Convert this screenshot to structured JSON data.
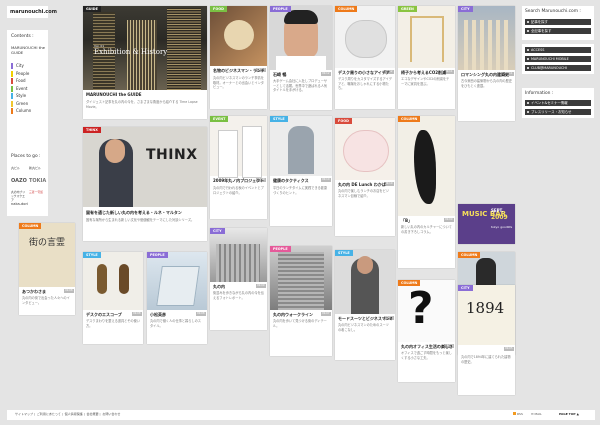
{
  "logo": "marunouchi.com",
  "contents": {
    "title": "Contents :",
    "guide": "MARUNOUCHI the GUIDE",
    "categories": [
      {
        "label": "City",
        "color": "#8a6dd6"
      },
      {
        "label": "People",
        "color": "#f2cf00"
      },
      {
        "label": "Food",
        "color": "#d94b3c"
      },
      {
        "label": "Event",
        "color": "#7ac043"
      },
      {
        "label": "Style",
        "color": "#46b2e6"
      },
      {
        "label": "Green",
        "color": "#f0c62e"
      },
      {
        "label": "Column",
        "color": "#ee7a1a"
      }
    ],
    "thinx": "THINX",
    "thinx_color": "#cc2222"
  },
  "places": {
    "title": "Places to go :",
    "logos": [
      "丸ビル",
      "新丸ビル",
      "OAZO",
      "TOKIA",
      "丸の内ブリックスクエア",
      "三菱一号館",
      "naka-dori"
    ]
  },
  "search": {
    "title": "Search Marunouchi.com :",
    "buttons": [
      "記事を探す",
      "全記事を探す"
    ]
  },
  "accounts": {
    "buttons": [
      "ACCESS",
      "MARUNOUCHI MOBILE",
      "CLUB@MARUNOUCHI"
    ]
  },
  "information": {
    "title": "Information :",
    "buttons": [
      "イベント&セミナー情報",
      "プレスリリース・お知らせ"
    ]
  },
  "cards": {
    "guide": {
      "tag": "GUIDE",
      "heading_small": "Vol. 01",
      "heading": "Exhibition & History",
      "title": "MARUNOUCHI the GUIDE",
      "text": "ダイジェスト記事を丸の内の今を、さまざまな角度から紹介する Time Lapse Movie。"
    },
    "food1": {
      "tag": "FOOD",
      "date": "09.12",
      "title": "名物のビジネスマン・ランチ事情",
      "text": "丸の内ビジネスマンのランチ事情を取材。オーナーとの出会いとインタビュー。"
    },
    "people1": {
      "tag": "PEOPLE",
      "date": "09.12",
      "title": "石崎 暢",
      "text": "大手ゲーム会社に入社しプロデューサーとして活躍。世界中で遊ばれる人気タイトルを手がける。"
    },
    "column1": {
      "tag": "COLUMN",
      "date": "09.12",
      "title": "デスク周りの小さなアイデア",
      "text": "デスク周りをカスタマイズするアイデアと、職場をおしゃれにする小物たち。"
    },
    "green1": {
      "tag": "GREEN",
      "date": "09.11",
      "title": "椅子から考えるCO2削減",
      "text": "エコなデザインやCO2の削減をテーマに家具を選ぶ。"
    },
    "city1": {
      "tag": "CITY",
      "date": "09.11",
      "title": "ロマンシング丸の内建築史",
      "text": "古今東西の建築物から丸の内の歴史をひもとく連載。"
    },
    "thinx": {
      "tag": "THINX",
      "heading": "THINX",
      "title": "固有を通じた新しい丸の内を考える・ルネ・マルタン",
      "text": "固有な場所から生まれる新しい文化や価値観をテーマにした対談シリーズ。"
    },
    "event1": {
      "tag": "EVENT",
      "date": "09.10",
      "title": "2009年丸ノ内プロジェクト",
      "text": "丸の内で行われる秋のイベントとプロジェクトの紹介。"
    },
    "style1": {
      "tag": "STYLE",
      "date": "09.10",
      "title": "健康のタクティクス",
      "text": "平日のランチタイムに実践できる健康づくりのヒント。"
    },
    "food2": {
      "tag": "FOOD",
      "date": "09.10",
      "title": "丸の内 DE Lunch わかば",
      "text": "丸の内で楽しむランチのお店をビジネスマン目線で紹介。"
    },
    "column2": {
      "tag": "COLUMN",
      "date": "09.09",
      "title": "「B」",
      "text": "新しい丸の内のカルチャーについての書き下ろしコラム。"
    },
    "city2": {
      "tag": "CITY",
      "date": "09.09",
      "title": "丸の内",
      "text": "街並みを歩きながら丸の内の今を伝えるフォトレポート。"
    },
    "column3": {
      "tag": "COLUMN",
      "date": "09.08",
      "title": "あつかわさま",
      "text": "丸の内の街で出会った人々へのインタビュー。"
    },
    "style2": {
      "tag": "STYLE",
      "date": "09.08",
      "title": "デスクのエスコープ",
      "text": "デスクまわりを整える道具とその使い方。"
    },
    "people2": {
      "tag": "PEOPLE",
      "date": "09.08",
      "title": "小松英彦",
      "text": "丸の内で働く人の仕事と暮らしのスタイル。"
    },
    "people3": {
      "tag": "PEOPLE",
      "date": "09.07",
      "title": "丸の内ウォークライン",
      "text": "丸の内を歩いて見つける街のディテール。"
    },
    "style3": {
      "tag": "STYLE",
      "date": "09.07",
      "title": "モードスーツとビジネスマンの装い",
      "text": "丸の内ビジネスマンのためのスーツの着こなし。"
    },
    "column4": {
      "tag": "COLUMN",
      "date": "09.06",
      "title": "丸の内オフィス生活の楽しさ",
      "text": "オフィスで過ごす時間をもっと楽しくする小さな工夫。"
    },
    "column5": {
      "tag": "COLUMN",
      "date": "09.06",
      "title": "バカンスの雑誌",
      "text": "秋の休暇を楽しむための旅の情報。"
    },
    "city3": {
      "tag": "CITY",
      "date": "09.05",
      "title": "1894",
      "text": "丸の内で1894年に建てられた建物の歴史。"
    },
    "banner": {
      "title": "MUSIC BAR",
      "line2": "SEPT.",
      "line3": "2009",
      "sub": "tokyo goodlife"
    }
  },
  "footer": {
    "links": [
      "サイトマップ",
      "ご利用にあたって",
      "個人情報保護",
      "会社概要",
      "お問い合わせ"
    ],
    "rss": "RSS",
    "mail": "MAIL",
    "pagetop": "PAGE TOP"
  }
}
